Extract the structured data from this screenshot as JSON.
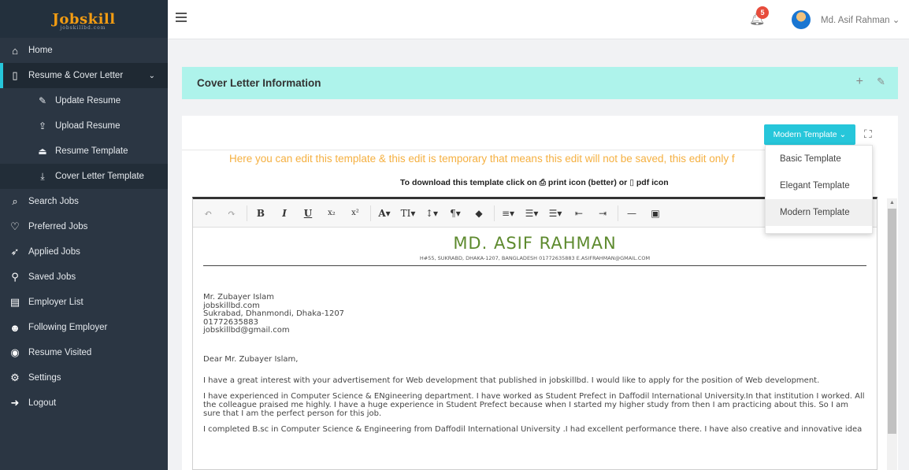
{
  "brand": {
    "logo_text": "Jobskill",
    "logo_sub": "jobskillbd.com"
  },
  "sidebar": {
    "items": [
      {
        "label": "Home",
        "icon": "home-icon"
      },
      {
        "label": "Resume & Cover Letter",
        "icon": "file-icon",
        "expanded": true
      },
      {
        "label": "Search Jobs",
        "icon": "search-icon"
      },
      {
        "label": "Preferred Jobs",
        "icon": "heart-icon"
      },
      {
        "label": "Applied Jobs",
        "icon": "send-icon"
      },
      {
        "label": "Saved Jobs",
        "icon": "pin-icon"
      },
      {
        "label": "Employer List",
        "icon": "list-icon"
      },
      {
        "label": "Following Employer",
        "icon": "users-icon"
      },
      {
        "label": "Resume Visited",
        "icon": "eye-icon"
      },
      {
        "label": "Settings",
        "icon": "gear-icon"
      },
      {
        "label": "Logout",
        "icon": "logout-icon"
      }
    ],
    "subitems": [
      {
        "label": "Update Resume",
        "icon": "edit-icon"
      },
      {
        "label": "Upload Resume",
        "icon": "upload-icon"
      },
      {
        "label": "Resume Template",
        "icon": "eject-icon"
      },
      {
        "label": "Cover Letter Template",
        "icon": "download-icon",
        "current": true
      }
    ]
  },
  "header": {
    "notification_count": "5",
    "user_name": "Md. Asif Rahman"
  },
  "panel": {
    "title": "Cover Letter Information"
  },
  "template_selector": {
    "selected": "Modern Template",
    "options": [
      "Basic Template",
      "Elegant Template",
      "Modern Template"
    ]
  },
  "notice": "Here you can edit this template & this edit is temporary that means this edit will not be saved, this edit only f",
  "download_hint": {
    "prefix": "To download this template click on",
    "print": "print icon (better) or",
    "pdf": "pdf icon"
  },
  "document": {
    "name": "MD. ASIF RAHMAN",
    "contact": "H#55, SUKRABD, DHAKA-1207, BANGLADESH  01772635883  E.ASIFRAHMAN@GMAIL.COM",
    "recipient": [
      "Mr. Zubayer Islam",
      "jobskillbd.com",
      "Sukrabad, Dhanmondi, Dhaka-1207",
      "01772635883",
      "jobskillbd@gmail.com"
    ],
    "salutation": "Dear Mr. Zubayer Islam,",
    "paragraphs": [
      "I have a great interest with your advertisement for Web development that published in jobskillbd. I would like to apply for the position of Web development.",
      "I have experienced in Computer Science & ENgineering department. I have worked as Student Prefect in Daffodil International University.In that institution I worked. All the colleague praised me highly. I have a huge experience in Student Prefect because when I started my higher study from then I am practicing about this. So I am sure that I am the perfect person for this job.",
      "I completed B.sc in Computer Science & Engineering from Daffodil International University .I had excellent performance there. I have also creative and innovative idea"
    ]
  }
}
